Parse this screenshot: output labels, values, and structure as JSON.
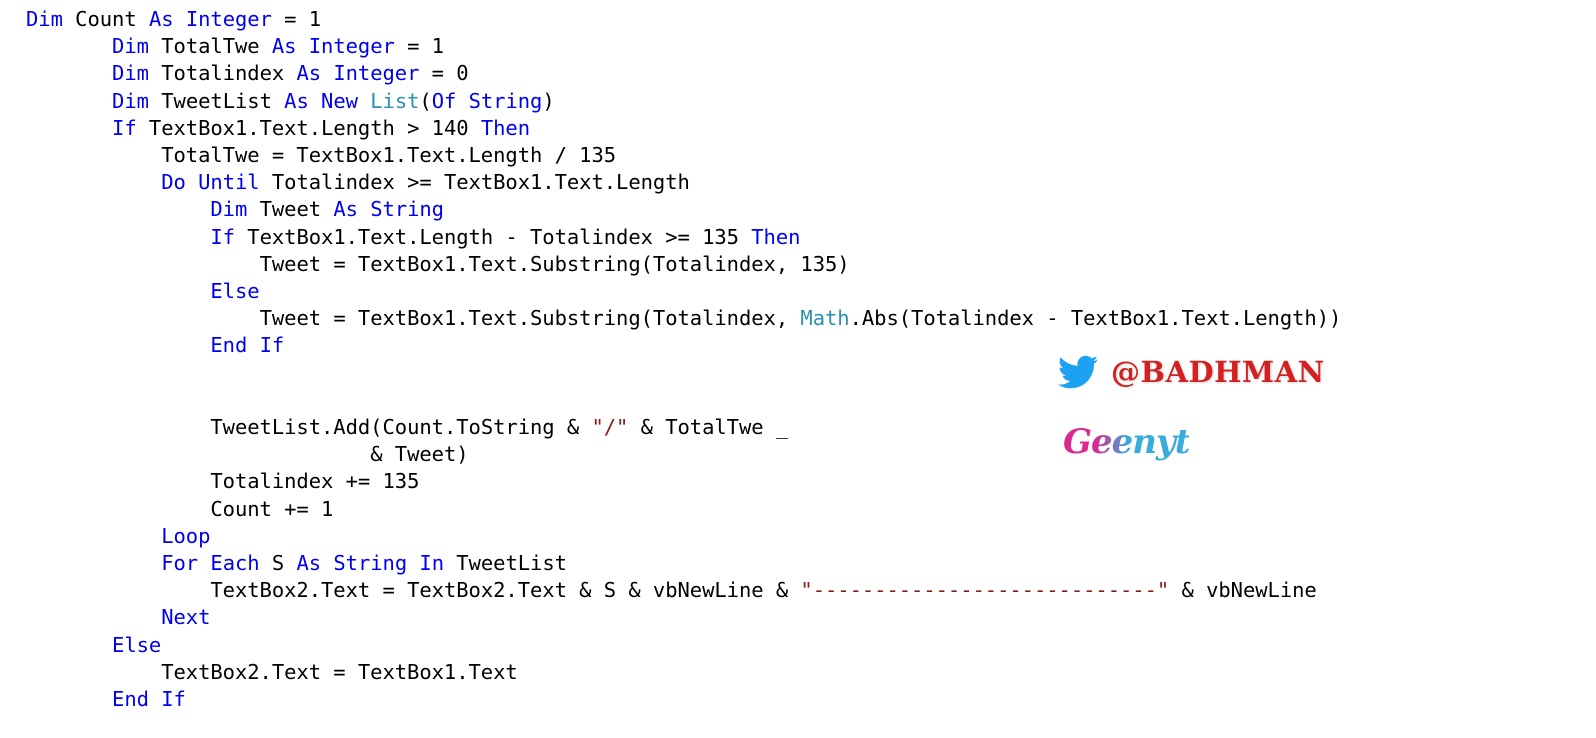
{
  "app": {
    "kind": "code-snippet-screenshot",
    "language": "VB.NET"
  },
  "colors": {
    "background": "#FFFFFF",
    "keyword": "#0000F0",
    "type": "#2B91AF",
    "string": "#8B1A1A",
    "plain": "#000000",
    "twitter_blue": "#1DA1F2",
    "handle_red": "#D42020",
    "logo_pink": "#D6208C",
    "logo_cyan": "#2FA8D8"
  },
  "code": {
    "lines": [
      {
        "indent": 0,
        "tokens": [
          {
            "t": "Dim",
            "c": "kw"
          },
          {
            "t": " Count ",
            "c": "plain"
          },
          {
            "t": "As",
            "c": "kw"
          },
          {
            "t": " ",
            "c": "plain"
          },
          {
            "t": "Integer",
            "c": "kw"
          },
          {
            "t": " = 1",
            "c": "plain"
          }
        ]
      },
      {
        "indent": 7,
        "tokens": [
          {
            "t": "Dim",
            "c": "kw"
          },
          {
            "t": " TotalTwe ",
            "c": "plain"
          },
          {
            "t": "As",
            "c": "kw"
          },
          {
            "t": " ",
            "c": "plain"
          },
          {
            "t": "Integer",
            "c": "kw"
          },
          {
            "t": " = 1",
            "c": "plain"
          }
        ]
      },
      {
        "indent": 7,
        "tokens": [
          {
            "t": "Dim",
            "c": "kw"
          },
          {
            "t": " Totalindex ",
            "c": "plain"
          },
          {
            "t": "As",
            "c": "kw"
          },
          {
            "t": " ",
            "c": "plain"
          },
          {
            "t": "Integer",
            "c": "kw"
          },
          {
            "t": " = 0",
            "c": "plain"
          }
        ]
      },
      {
        "indent": 7,
        "tokens": [
          {
            "t": "Dim",
            "c": "kw"
          },
          {
            "t": " TweetList ",
            "c": "plain"
          },
          {
            "t": "As",
            "c": "kw"
          },
          {
            "t": " ",
            "c": "plain"
          },
          {
            "t": "New",
            "c": "kw"
          },
          {
            "t": " ",
            "c": "plain"
          },
          {
            "t": "List",
            "c": "type"
          },
          {
            "t": "(",
            "c": "plain"
          },
          {
            "t": "Of",
            "c": "kw"
          },
          {
            "t": " ",
            "c": "plain"
          },
          {
            "t": "String",
            "c": "kw"
          },
          {
            "t": ")",
            "c": "plain"
          }
        ]
      },
      {
        "indent": 7,
        "tokens": [
          {
            "t": "If",
            "c": "kw"
          },
          {
            "t": " TextBox1.Text.Length > 140 ",
            "c": "plain"
          },
          {
            "t": "Then",
            "c": "kw"
          }
        ]
      },
      {
        "indent": 11,
        "tokens": [
          {
            "t": "TotalTwe = TextBox1.Text.Length / 135",
            "c": "plain"
          }
        ]
      },
      {
        "indent": 11,
        "tokens": [
          {
            "t": "Do",
            "c": "kw"
          },
          {
            "t": " ",
            "c": "plain"
          },
          {
            "t": "Until",
            "c": "kw"
          },
          {
            "t": " Totalindex >= TextBox1.Text.Length",
            "c": "plain"
          }
        ]
      },
      {
        "indent": 15,
        "tokens": [
          {
            "t": "Dim",
            "c": "kw"
          },
          {
            "t": " Tweet ",
            "c": "plain"
          },
          {
            "t": "As",
            "c": "kw"
          },
          {
            "t": " ",
            "c": "plain"
          },
          {
            "t": "String",
            "c": "kw"
          }
        ]
      },
      {
        "indent": 15,
        "tokens": [
          {
            "t": "If",
            "c": "kw"
          },
          {
            "t": " TextBox1.Text.Length - Totalindex >= 135 ",
            "c": "plain"
          },
          {
            "t": "Then",
            "c": "kw"
          }
        ]
      },
      {
        "indent": 19,
        "tokens": [
          {
            "t": "Tweet = TextBox1.Text.Substring(Totalindex, 135)",
            "c": "plain"
          }
        ]
      },
      {
        "indent": 15,
        "tokens": [
          {
            "t": "Else",
            "c": "kw"
          }
        ]
      },
      {
        "indent": 19,
        "tokens": [
          {
            "t": "Tweet = TextBox1.Text.Substring(Totalindex, ",
            "c": "plain"
          },
          {
            "t": "Math",
            "c": "type"
          },
          {
            "t": ".Abs(Totalindex - TextBox1.Text.Length))",
            "c": "plain"
          }
        ]
      },
      {
        "indent": 15,
        "tokens": [
          {
            "t": "End",
            "c": "kw"
          },
          {
            "t": " ",
            "c": "plain"
          },
          {
            "t": "If",
            "c": "kw"
          }
        ]
      },
      {
        "indent": 0,
        "tokens": []
      },
      {
        "indent": 0,
        "tokens": []
      },
      {
        "indent": 15,
        "tokens": [
          {
            "t": "TweetList.Add(Count.ToString & ",
            "c": "plain"
          },
          {
            "t": "\"/\"",
            "c": "str"
          },
          {
            "t": " & TotalTwe _",
            "c": "plain"
          }
        ]
      },
      {
        "indent": 28,
        "tokens": [
          {
            "t": "& Tweet)",
            "c": "plain"
          }
        ]
      },
      {
        "indent": 15,
        "tokens": [
          {
            "t": "Totalindex += 135",
            "c": "plain"
          }
        ]
      },
      {
        "indent": 15,
        "tokens": [
          {
            "t": "Count += 1",
            "c": "plain"
          }
        ]
      },
      {
        "indent": 11,
        "tokens": [
          {
            "t": "Loop",
            "c": "kw"
          }
        ]
      },
      {
        "indent": 11,
        "tokens": [
          {
            "t": "For",
            "c": "kw"
          },
          {
            "t": " ",
            "c": "plain"
          },
          {
            "t": "Each",
            "c": "kw"
          },
          {
            "t": " S ",
            "c": "plain"
          },
          {
            "t": "As",
            "c": "kw"
          },
          {
            "t": " ",
            "c": "plain"
          },
          {
            "t": "String",
            "c": "kw"
          },
          {
            "t": " ",
            "c": "plain"
          },
          {
            "t": "In",
            "c": "kw"
          },
          {
            "t": " TweetList",
            "c": "plain"
          }
        ]
      },
      {
        "indent": 15,
        "tokens": [
          {
            "t": "TextBox2.Text = TextBox2.Text & S & vbNewLine & ",
            "c": "plain"
          },
          {
            "t": "\"----------------------------\"",
            "c": "str"
          },
          {
            "t": " & vbNewLine",
            "c": "plain"
          }
        ]
      },
      {
        "indent": 11,
        "tokens": [
          {
            "t": "Next",
            "c": "kw"
          }
        ]
      },
      {
        "indent": 7,
        "tokens": [
          {
            "t": "Else",
            "c": "kw"
          }
        ]
      },
      {
        "indent": 11,
        "tokens": [
          {
            "t": "TextBox2.Text = TextBox1.Text",
            "c": "plain"
          }
        ]
      },
      {
        "indent": 7,
        "tokens": [
          {
            "t": "End",
            "c": "kw"
          },
          {
            "t": " ",
            "c": "plain"
          },
          {
            "t": "If",
            "c": "kw"
          }
        ]
      }
    ]
  },
  "watermark": {
    "bird_icon": "twitter-bird-icon",
    "handle": "@BADHMAN",
    "logo_text": "Geenyt"
  }
}
